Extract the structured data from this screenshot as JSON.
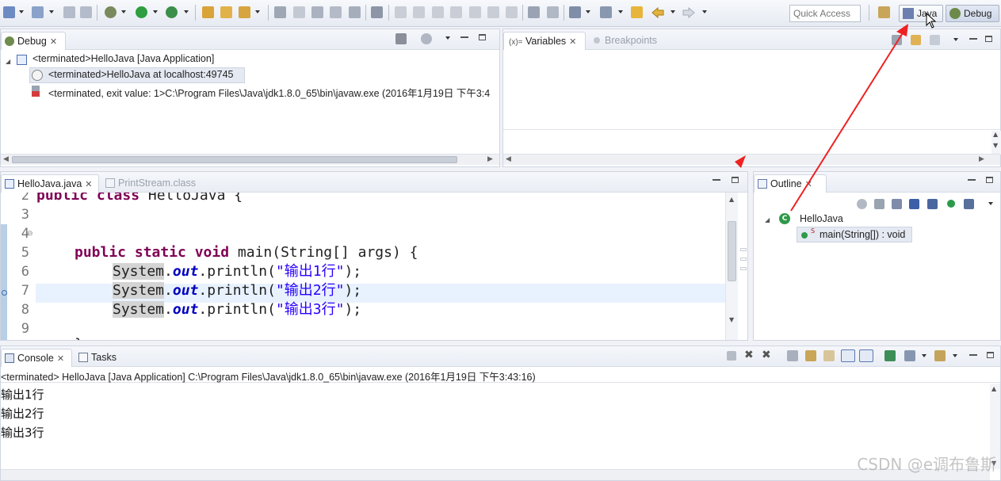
{
  "toolbar": {
    "quick_access_placeholder": "Quick Access",
    "perspectives": [
      {
        "label": "Java"
      },
      {
        "label": "Debug"
      }
    ]
  },
  "debug_view": {
    "tab_label": "Debug",
    "tree": [
      {
        "text": "<terminated>HelloJava [Java Application]"
      },
      {
        "text": "<terminated>HelloJava at localhost:49745"
      },
      {
        "text": "<terminated, exit value: 1>C:\\Program Files\\Java\\jdk1.8.0_65\\bin\\javaw.exe (2016年1月19日 下午3:4"
      }
    ]
  },
  "variables_view": {
    "tabs": [
      {
        "label": "Variables"
      },
      {
        "label": "Breakpoints"
      }
    ],
    "variables_prefix": "(x)="
  },
  "editor": {
    "tabs": [
      {
        "label": "HelloJava.java"
      },
      {
        "label": "PrintStream.class"
      }
    ],
    "line_numbers": [
      "2",
      "3",
      "4",
      "5",
      "6",
      "7",
      "8",
      "9"
    ],
    "lines": {
      "l2_kw": "public class",
      "l2_rest": " HelloJava {",
      "l4_kw": "public static void",
      "l4_rest": " main(String[] args) {",
      "system": "System",
      "dot": ".",
      "out": "out",
      "println": ".println(",
      "str1": "\"输出1行\"",
      "str2": "\"输出2行\"",
      "str3": "\"输出3行\"",
      "close": ");",
      "l9": "}"
    }
  },
  "outline_view": {
    "tab_label": "Outline",
    "class_name": "HelloJava",
    "method": "main(String[]) : void",
    "static_marker": "S"
  },
  "console_view": {
    "tabs": [
      {
        "label": "Console"
      },
      {
        "label": "Tasks"
      }
    ],
    "status": "<terminated> HelloJava [Java Application] C:\\Program Files\\Java\\jdk1.8.0_65\\bin\\javaw.exe (2016年1月19日 下午3:43:16)",
    "output": [
      "输出1行",
      "输出2行",
      "输出3行"
    ]
  },
  "watermark": "CSDN @e调布鲁斯",
  "colors": {
    "keyword": "#7f0055",
    "field": "#0000c0",
    "string": "#2a00ff",
    "annotation_arrow": "#ee2222"
  }
}
